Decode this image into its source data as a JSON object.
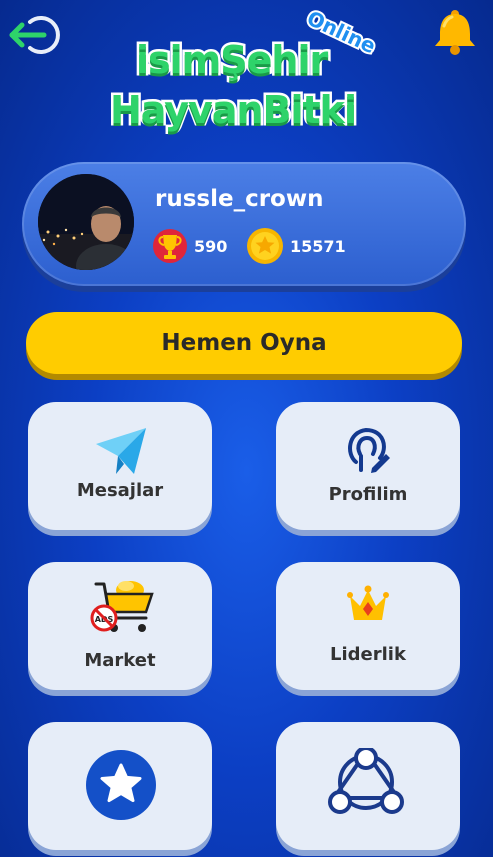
{
  "logo": {
    "line1": "isimŞehir",
    "line2": "HayvanBitki",
    "badge": "Online"
  },
  "profile": {
    "username": "russle_crown",
    "trophies": "590",
    "coins": "15571"
  },
  "play_label": "Hemen Oyna",
  "tiles": {
    "messages": "Mesajlar",
    "profile": "Profilim",
    "market": "Market",
    "leaderboard": "Liderlik",
    "ads_badge": "ADS"
  },
  "icons": {
    "back": "exit-arrow-icon",
    "bell": "bell-icon",
    "trophy": "trophy-icon",
    "coin": "star-coin-icon",
    "messages": "paper-plane-icon",
    "profile": "user-edit-icon",
    "market": "shopping-cart-icon",
    "leaderboard": "crown-icon",
    "favorites": "star-circle-icon",
    "share": "share-network-icon"
  },
  "colors": {
    "background": "#0c3fc4",
    "play_button": "#ffcc00",
    "tile": "#e6edf8",
    "logo_green": "#2ed36a",
    "logo_blue": "#1f8ff0"
  }
}
